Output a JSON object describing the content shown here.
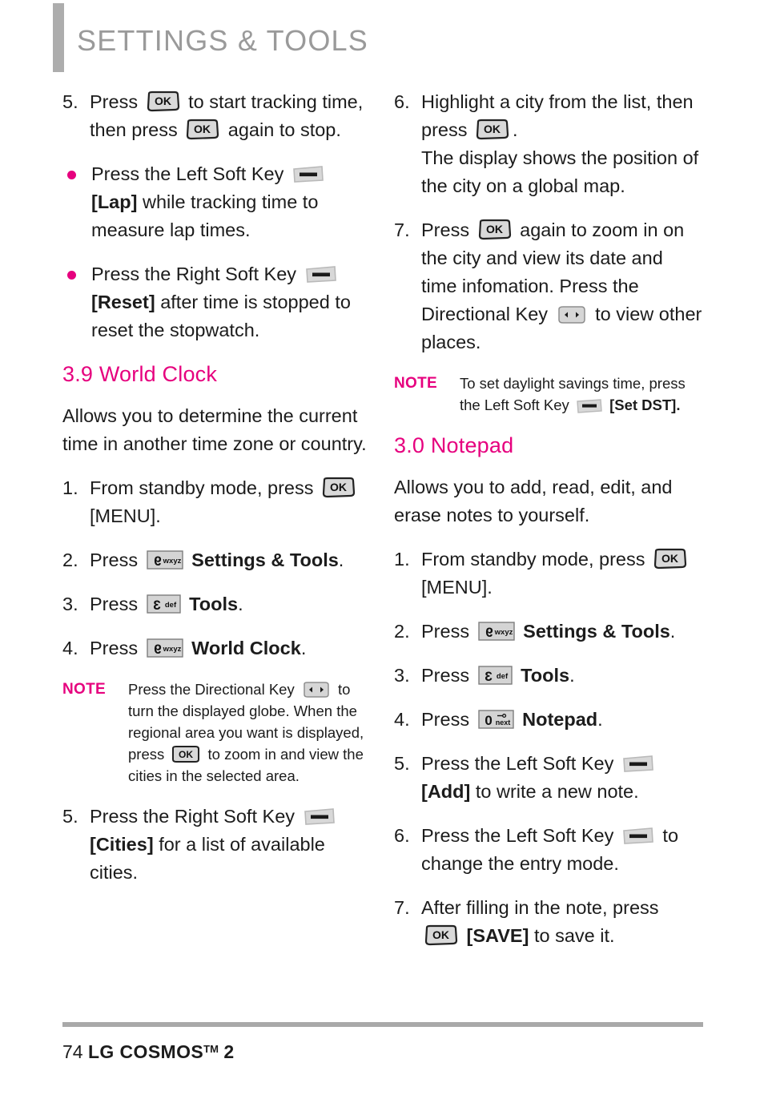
{
  "header": {
    "title": "SETTINGS & TOOLS",
    "accent_gray": "#9a9a9a",
    "bar_color": "#adadad"
  },
  "colors": {
    "accent_magenta": "#e6007e",
    "body_text": "#1c1c1c",
    "key_fill": "#d9d9d9"
  },
  "icons": {
    "ok_key": "ok-key-icon",
    "soft_key": "soft-key-icon",
    "directional_key": "directional-key-icon",
    "key_9": "keypad-9-wxyz-icon",
    "key_3": "keypad-3-def-icon",
    "key_0": "keypad-0-next-icon"
  },
  "left_column": {
    "step5": {
      "number": "5.",
      "text_a": "Press",
      "text_b": "to start tracking time,",
      "text_c": "then press",
      "text_d": "again to stop."
    },
    "bullet1": {
      "text_a": "Press the Left Soft Key",
      "label": "[Lap]",
      "text_b": "while tracking time to measure lap times."
    },
    "bullet2": {
      "text_a": "Press the Right Soft Key",
      "label": "[Reset]",
      "text_b": "after time is stopped to reset the stopwatch."
    },
    "section": {
      "heading": "3.9 World Clock",
      "intro": "Allows you to determine the current time in another time zone or country."
    },
    "steps": [
      {
        "number": "1.",
        "text_a": "From standby mode, press",
        "text_b": "[MENU]."
      },
      {
        "number": "2.",
        "text_a": "Press",
        "label": "Settings & Tools",
        "text_b": "."
      },
      {
        "number": "3.",
        "text_a": "Press",
        "label": "Tools",
        "text_b": "."
      },
      {
        "number": "4.",
        "text_a": "Press",
        "label": "World Clock",
        "text_b": "."
      }
    ],
    "note": {
      "label": "NOTE",
      "text_a": "Press the Directional Key",
      "text_b": "to turn the displayed globe. When the regional area you want is displayed, press",
      "text_c": "to zoom in and view the cities in the selected area."
    },
    "step5b": {
      "number": "5.",
      "text_a": "Press the Right Soft Key",
      "label": "[Cities]",
      "text_b": "for a list of available cities."
    }
  },
  "right_column": {
    "step6": {
      "number": "6.",
      "text_a": "Highlight a city from the list, then press",
      "text_b": ".",
      "text_c": "The display shows the position of the city on a global map."
    },
    "step7": {
      "number": "7.",
      "text_a": "Press",
      "text_b": "again to zoom in on the city and view its date and time infomation. Press the Directional Key",
      "text_c": "to view other places."
    },
    "note": {
      "label": "NOTE",
      "text_a": "To set daylight savings time, press the Left Soft Key",
      "text_b": "[Set DST]."
    },
    "section": {
      "heading": "3.0 Notepad",
      "intro": "Allows you to add, read, edit, and erase notes to yourself."
    },
    "steps": [
      {
        "number": "1.",
        "text_a": "From standby mode, press",
        "text_b": "[MENU]."
      },
      {
        "number": "2.",
        "text_a": "Press",
        "label": "Settings & Tools",
        "text_b": "."
      },
      {
        "number": "3.",
        "text_a": "Press",
        "label": "Tools",
        "text_b": "."
      },
      {
        "number": "4.",
        "text_a": "Press",
        "label": "Notepad",
        "text_b": "."
      },
      {
        "number": "5.",
        "text_a": "Press the Left Soft Key",
        "label": "[Add]",
        "text_b": "to write a new note."
      },
      {
        "number": "6.",
        "text_a": "Press the Left Soft Key",
        "text_b": "to change the entry mode."
      },
      {
        "number": "7.",
        "text_a": "After filling in the note, press",
        "label": "[SAVE]",
        "text_b": "to save it."
      }
    ]
  },
  "footer": {
    "page_number": "74",
    "brand": "LG COSMOS",
    "tm": "TM",
    "model": "2"
  }
}
